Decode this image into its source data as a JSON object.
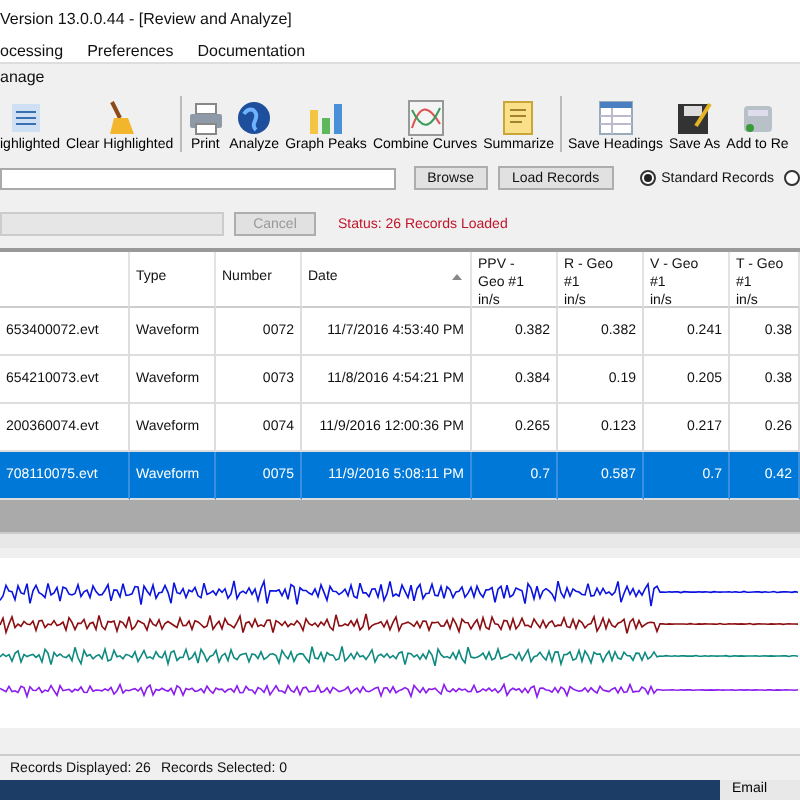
{
  "window": {
    "title": "Version 13.0.0.44 - [Review and Analyze]"
  },
  "menu": [
    "ocessing",
    "Preferences",
    "Documentation"
  ],
  "ribbon_tab": "anage",
  "toolbar": [
    {
      "kind": "button",
      "label": "ighlighted"
    },
    {
      "kind": "button",
      "label": "Clear Highlighted"
    },
    {
      "kind": "separator"
    },
    {
      "kind": "button",
      "label": "Print"
    },
    {
      "kind": "button",
      "label": "Analyze"
    },
    {
      "kind": "button",
      "label": "Graph Peaks"
    },
    {
      "kind": "button",
      "label": "Combine Curves"
    },
    {
      "kind": "button",
      "label": "Summarize"
    },
    {
      "kind": "separator"
    },
    {
      "kind": "button",
      "label": "Save Headings"
    },
    {
      "kind": "button",
      "label": "Save As"
    },
    {
      "kind": "button",
      "label": "Add to Re"
    }
  ],
  "load": {
    "browse": "Browse",
    "load": "Load Records",
    "radios": [
      {
        "label": "Standard Records",
        "selected": true
      },
      {
        "selected": false
      }
    ]
  },
  "progress": {
    "level": 0,
    "cancel": "Cancel",
    "status": "Status: 26 Records Loaded"
  },
  "table": {
    "columns": [
      {},
      {
        "lines": [
          "Type"
        ]
      },
      {
        "lines": [
          "Number"
        ]
      },
      {
        "lines": [
          "Date"
        ],
        "sorted": true
      },
      {
        "lines": [
          "PPV -",
          "Geo #1",
          "in/s"
        ]
      },
      {
        "lines": [
          "R - Geo",
          "#1",
          "in/s"
        ]
      },
      {
        "lines": [
          "V - Geo",
          "#1",
          "in/s"
        ]
      },
      {
        "lines": [
          "T - Geo",
          "#1",
          "in/s"
        ]
      }
    ],
    "rows": [
      {
        "selected": false,
        "cells": [
          "653400072.evt",
          "Waveform",
          "0072",
          "11/7/2016 4:53:40 PM",
          "0.382",
          "0.382",
          "0.241",
          "0.38"
        ]
      },
      {
        "selected": false,
        "cells": [
          "654210073.evt",
          "Waveform",
          "0073",
          "11/8/2016 4:54:21 PM",
          "0.384",
          "0.19",
          "0.205",
          "0.38"
        ]
      },
      {
        "selected": false,
        "cells": [
          "200360074.evt",
          "Waveform",
          "0074",
          "11/9/2016 12:00:36 PM",
          "0.265",
          "0.123",
          "0.217",
          "0.26"
        ]
      },
      {
        "selected": true,
        "cells": [
          "708110075.evt",
          "Waveform",
          "0075",
          "11/9/2016 5:08:11 PM",
          "0.7",
          "0.587",
          "0.7",
          "0.42"
        ]
      }
    ]
  },
  "status_bar": {
    "displayed": "Records Displayed: 26",
    "selected": "Records Selected: 0"
  },
  "taskbar": {
    "button": "Email"
  }
}
